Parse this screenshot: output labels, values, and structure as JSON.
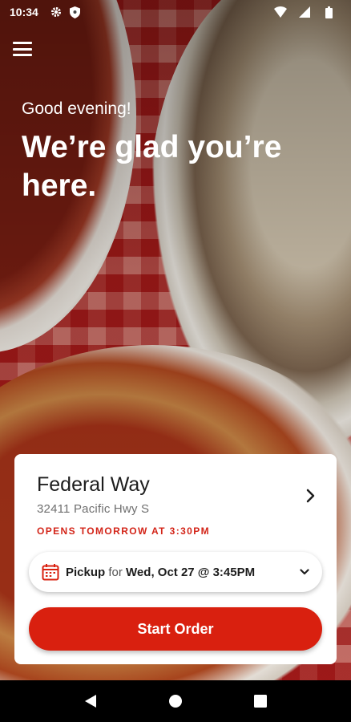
{
  "status_bar": {
    "time": "10:34",
    "icons_left": [
      "gear-icon",
      "shield-icon"
    ],
    "icons_right": [
      "wifi-icon",
      "signal-icon",
      "battery-icon"
    ]
  },
  "header": {
    "menu_icon": "hamburger-menu-icon",
    "greeting": "Good evening!",
    "headline": "We’re glad you’re here."
  },
  "store_card": {
    "name": "Federal Way",
    "address": "32411 Pacific Hwy S",
    "hours_status": "OPENS TOMORROW AT 3:30PM",
    "hours_color": "#d32418",
    "pickup": {
      "mode": "Pickup",
      "connector": "for",
      "datetime": "Wed, Oct 27 @ 3:45PM"
    },
    "start_button_label": "Start Order",
    "accent_color": "#d9200f"
  },
  "nav_bar": {
    "items": [
      "back-icon",
      "home-icon",
      "recents-icon"
    ]
  }
}
